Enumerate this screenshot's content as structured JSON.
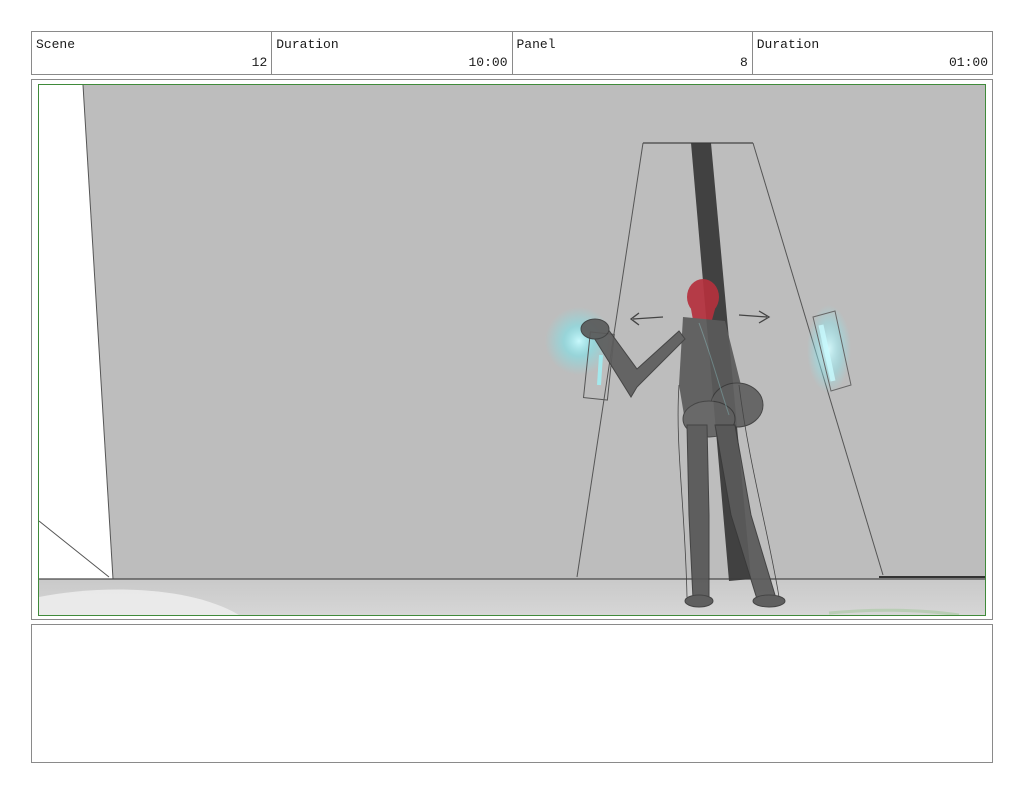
{
  "header": {
    "scene_label": "Scene",
    "scene_value": "12",
    "duration_label": "Duration",
    "duration_value": "10:00",
    "panel_label": "Panel",
    "panel_value": "8",
    "panel_duration_label": "Duration",
    "panel_duration_value": "01:00"
  },
  "panel": {
    "illustration": "storyboard-sketch-figure-at-glowing-doorway",
    "colors": {
      "wall": "#bdbdbd",
      "floor": "#cfcfcf",
      "figure": "#5b5b5b",
      "pole": "#3a3a3a",
      "hair": "#b5313d",
      "glow": "#7fe3ea",
      "frame": "#3f8a3a"
    }
  },
  "notes": {
    "text": ""
  }
}
